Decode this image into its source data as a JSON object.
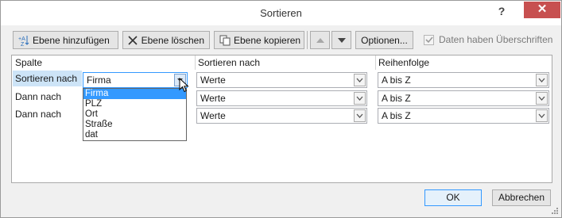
{
  "window": {
    "title": "Sortieren",
    "help": "?",
    "close": "✕"
  },
  "toolbar": {
    "add_level": "Ebene hinzufügen",
    "delete_level": "Ebene löschen",
    "copy_level": "Ebene kopieren",
    "options": "Optionen...",
    "headers_checkbox_label": "Daten haben Überschriften",
    "headers_checked": true
  },
  "grid": {
    "headers": {
      "column": "Spalte",
      "sort_on": "Sortieren nach",
      "order": "Reihenfolge"
    },
    "rows": [
      {
        "label": "Sortieren nach",
        "column_value": "Firma",
        "sort_on": "Werte",
        "order": "A bis Z"
      },
      {
        "label": "Dann nach",
        "column_value": "",
        "sort_on": "Werte",
        "order": "A bis Z"
      },
      {
        "label": "Dann nach",
        "column_value": "",
        "sort_on": "Werte",
        "order": "A bis Z"
      }
    ]
  },
  "column_dropdown": {
    "options": [
      "Firma",
      "PLZ",
      "Ort",
      "Straße",
      "dat"
    ],
    "selected": "Firma"
  },
  "footer": {
    "ok": "OK",
    "cancel": "Abbrechen"
  },
  "colors": {
    "selection": "#3399ff",
    "close_button": "#c75050"
  }
}
